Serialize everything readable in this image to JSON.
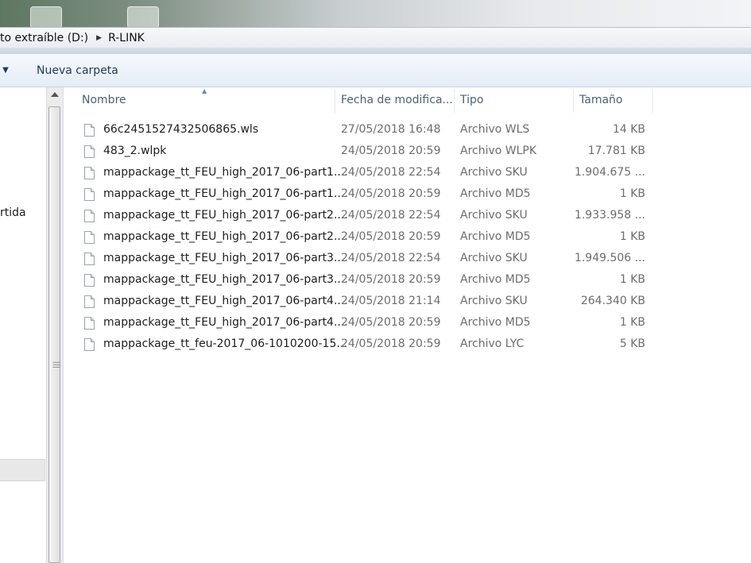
{
  "address": {
    "crumbs": [
      "to extraíble (D:)",
      "R-LINK"
    ]
  },
  "toolbar": {
    "new_folder_label": "Nueva carpeta"
  },
  "nav": {
    "partial_text": "rtida"
  },
  "columns": {
    "name": "Nombre",
    "date": "Fecha de modifica...",
    "type": "Tipo",
    "size": "Tamaño",
    "sorted_by": "Nombre"
  },
  "files": [
    {
      "name": "66c2451527432506865.wls",
      "date": "27/05/2018 16:48",
      "type": "Archivo WLS",
      "size": "14 KB"
    },
    {
      "name": "483_2.wlpk",
      "date": "24/05/2018 20:59",
      "type": "Archivo WLPK",
      "size": "17.781 KB"
    },
    {
      "name": "mappackage_tt_FEU_high_2017_06-part1....",
      "date": "24/05/2018 22:54",
      "type": "Archivo SKU",
      "size": "1.904.675 ..."
    },
    {
      "name": "mappackage_tt_FEU_high_2017_06-part1....",
      "date": "24/05/2018 20:59",
      "type": "Archivo MD5",
      "size": "1 KB"
    },
    {
      "name": "mappackage_tt_FEU_high_2017_06-part2....",
      "date": "24/05/2018 22:54",
      "type": "Archivo SKU",
      "size": "1.933.958 ..."
    },
    {
      "name": "mappackage_tt_FEU_high_2017_06-part2....",
      "date": "24/05/2018 20:59",
      "type": "Archivo MD5",
      "size": "1 KB"
    },
    {
      "name": "mappackage_tt_FEU_high_2017_06-part3....",
      "date": "24/05/2018 22:54",
      "type": "Archivo SKU",
      "size": "1.949.506 ..."
    },
    {
      "name": "mappackage_tt_FEU_high_2017_06-part3....",
      "date": "24/05/2018 20:59",
      "type": "Archivo MD5",
      "size": "1 KB"
    },
    {
      "name": "mappackage_tt_FEU_high_2017_06-part4....",
      "date": "24/05/2018 21:14",
      "type": "Archivo SKU",
      "size": "264.340 KB"
    },
    {
      "name": "mappackage_tt_FEU_high_2017_06-part4....",
      "date": "24/05/2018 20:59",
      "type": "Archivo MD5",
      "size": "1 KB"
    },
    {
      "name": "mappackage_tt_feu-2017_06-1010200-15...",
      "date": "24/05/2018 20:59",
      "type": "Archivo LYC",
      "size": "5 KB"
    }
  ],
  "icons": {
    "breadcrumb_separator": "chevron-right-icon",
    "dropdown": "chevron-down-icon",
    "file": "file-icon",
    "sort": "sort-ascending-icon",
    "scroll_up": "scroll-up-arrow-icon"
  }
}
